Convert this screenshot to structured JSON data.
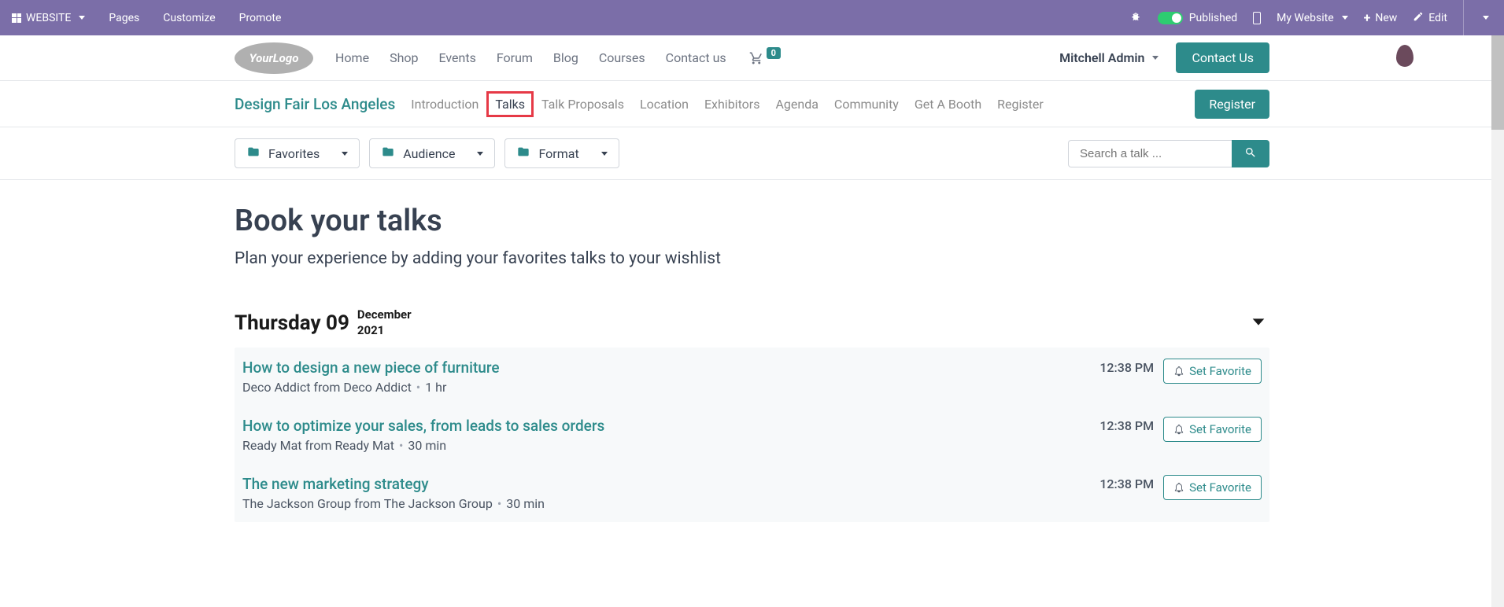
{
  "topbar": {
    "website_label": "WEBSITE",
    "pages_label": "Pages",
    "customize_label": "Customize",
    "promote_label": "Promote",
    "published_label": "Published",
    "my_website_label": "My Website",
    "new_label": "New",
    "edit_label": "Edit"
  },
  "mainnav": {
    "logo_text": "YourLogo",
    "links": {
      "home": "Home",
      "shop": "Shop",
      "events": "Events",
      "forum": "Forum",
      "blog": "Blog",
      "courses": "Courses",
      "contact": "Contact us"
    },
    "cart_count": "0",
    "user_name": "Mitchell Admin",
    "contact_btn": "Contact Us"
  },
  "subnav": {
    "event_title": "Design Fair Los Angeles",
    "tabs": {
      "introduction": "Introduction",
      "talks": "Talks",
      "proposals": "Talk Proposals",
      "location": "Location",
      "exhibitors": "Exhibitors",
      "agenda": "Agenda",
      "community": "Community",
      "booth": "Get A Booth",
      "register": "Register"
    },
    "register_btn": "Register"
  },
  "filters": {
    "favorites": "Favorites",
    "audience": "Audience",
    "format": "Format",
    "search_placeholder": "Search a talk ..."
  },
  "page": {
    "heading": "Book your talks",
    "subheading": "Plan your experience by adding your favorites talks to your wishlist"
  },
  "day": {
    "name": "Thursday 09",
    "month": "December",
    "year": "2021"
  },
  "talks": [
    {
      "title": "How to design a new piece of furniture",
      "speaker": "Deco Addict from Deco Addict",
      "duration": "1 hr",
      "time": "12:38 PM",
      "fav_label": "Set Favorite"
    },
    {
      "title": "How to optimize your sales, from leads to sales orders",
      "speaker": "Ready Mat from Ready Mat",
      "duration": "30 min",
      "time": "12:38 PM",
      "fav_label": "Set Favorite"
    },
    {
      "title": "The new marketing strategy",
      "speaker": "The Jackson Group from The Jackson Group",
      "duration": "30 min",
      "time": "12:38 PM",
      "fav_label": "Set Favorite"
    }
  ]
}
